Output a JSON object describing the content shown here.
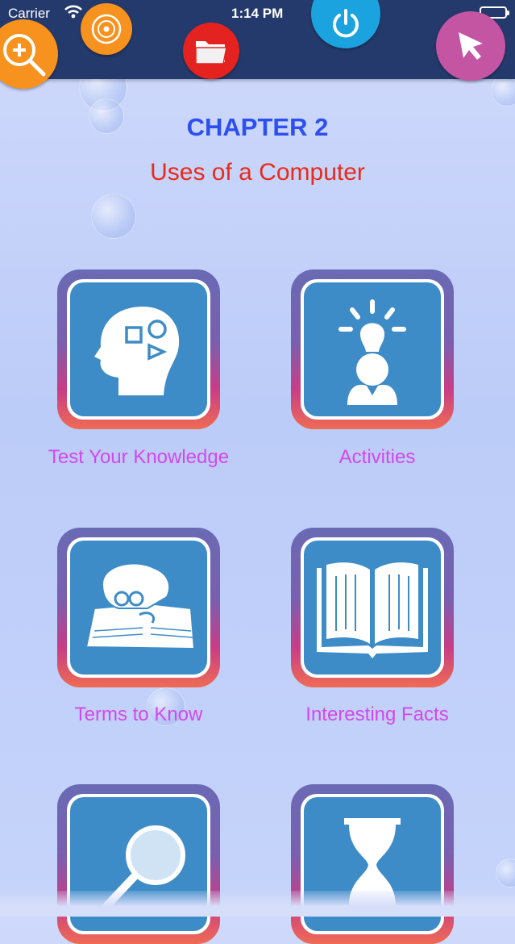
{
  "status_bar": {
    "carrier": "Carrier",
    "time": "1:14 PM"
  },
  "toolbar": {
    "tools": [
      {
        "name": "zoom-in-icon",
        "color": "#f7921e"
      },
      {
        "name": "disc-icon",
        "color": "#f7921e"
      },
      {
        "name": "folder-icon",
        "color": "#e42320"
      },
      {
        "name": "power-icon",
        "color": "#1ba3e0"
      },
      {
        "name": "cursor-icon",
        "color": "#c455a3"
      }
    ]
  },
  "header": {
    "chapter": "CHAPTER 2",
    "subtitle": "Uses of a Computer"
  },
  "tiles": [
    {
      "label": "Test Your Knowledge",
      "icon": "head-shapes-icon"
    },
    {
      "label": "Activities",
      "icon": "lightbulb-person-icon"
    },
    {
      "label": "Terms to Know",
      "icon": "reading-person-icon"
    },
    {
      "label": "Interesting Facts",
      "icon": "open-book-icon"
    },
    {
      "label": "",
      "icon": "magnifier-icon"
    },
    {
      "label": "",
      "icon": "hourglass-icon"
    }
  ],
  "colors": {
    "topbar": "#253a6c",
    "chapter": "#2c4ff0",
    "subtitle": "#ea2a1b",
    "tile_label": "#d347f0",
    "tile_face": "#3e8cc7"
  }
}
